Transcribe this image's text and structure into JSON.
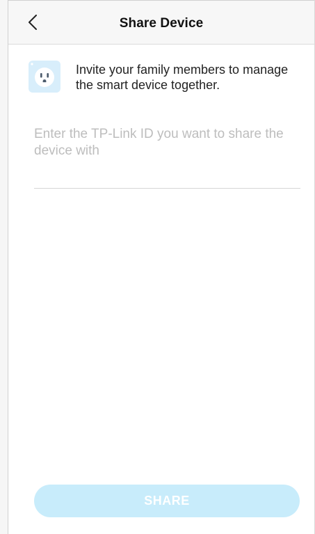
{
  "header": {
    "title": "Share Device",
    "back_icon": "chevron-left-icon"
  },
  "invite": {
    "icon": "smart-plug-icon",
    "text": "Invite your family members to manage the smart device together."
  },
  "share_input": {
    "value": "",
    "placeholder": "Enter the TP-Link ID you want to share the device with"
  },
  "share_button": {
    "label": "SHARE",
    "state": "disabled"
  },
  "colors": {
    "accent_disabled": "#c8ecfb",
    "plug_icon_bg": "#d8eefb",
    "placeholder": "#bdbdbd",
    "header_bg": "#f7f7f7"
  }
}
